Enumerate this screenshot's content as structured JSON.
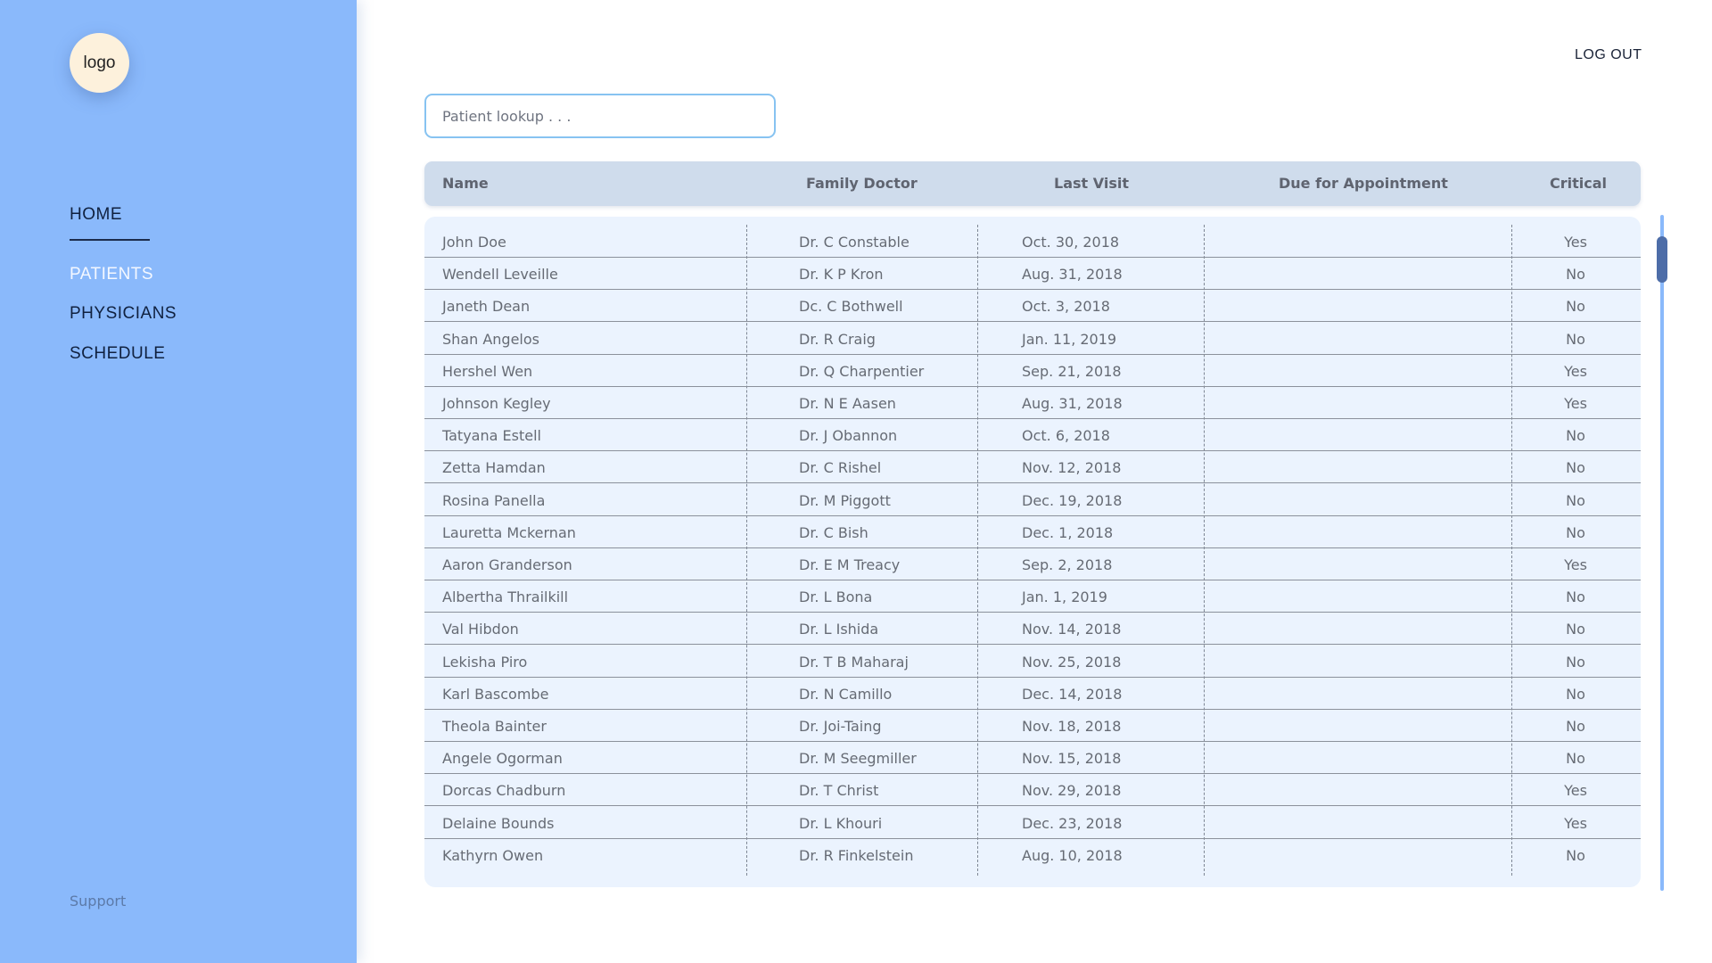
{
  "sidebar": {
    "logo": "logo",
    "nav": {
      "home": "HOME",
      "patients": "PATIENTS",
      "physicians": "PHYSICIANS",
      "schedule": "SCHEDULE"
    },
    "support": "Support"
  },
  "header": {
    "logout": "LOG OUT"
  },
  "search": {
    "placeholder": "Patient lookup . . ."
  },
  "table": {
    "columns": [
      "Name",
      "Family Doctor",
      "Last Visit",
      "Due for Appointment",
      "Critical"
    ],
    "rows": [
      {
        "name": "John Doe",
        "doctor": "Dr. C Constable",
        "last_visit": "Oct. 30, 2018",
        "due": "",
        "critical": "Yes"
      },
      {
        "name": "Wendell Leveille",
        "doctor": "Dr. K P Kron",
        "last_visit": "Aug. 31, 2018",
        "due": "",
        "critical": "No"
      },
      {
        "name": "Janeth Dean",
        "doctor": "Dc. C Bothwell",
        "last_visit": "Oct. 3, 2018",
        "due": "",
        "critical": "No"
      },
      {
        "name": "Shan Angelos",
        "doctor": "Dr. R Craig",
        "last_visit": "Jan. 11, 2019",
        "due": "",
        "critical": "No"
      },
      {
        "name": "Hershel Wen",
        "doctor": "Dr. Q Charpentier",
        "last_visit": "Sep. 21, 2018",
        "due": "",
        "critical": "Yes"
      },
      {
        "name": "Johnson Kegley",
        "doctor": "Dr. N E Aasen",
        "last_visit": "Aug. 31, 2018",
        "due": "",
        "critical": "Yes"
      },
      {
        "name": "Tatyana Estell",
        "doctor": "Dr. J Obannon",
        "last_visit": "Oct. 6, 2018",
        "due": "",
        "critical": "No"
      },
      {
        "name": "Zetta Hamdan",
        "doctor": "Dr. C Rishel",
        "last_visit": "Nov. 12, 2018",
        "due": "",
        "critical": "No"
      },
      {
        "name": "Rosina Panella",
        "doctor": "Dr. M Piggott",
        "last_visit": "Dec. 19, 2018",
        "due": "",
        "critical": "No"
      },
      {
        "name": "Lauretta Mckernan",
        "doctor": "Dr. C Bish",
        "last_visit": "Dec. 1, 2018",
        "due": "",
        "critical": "No"
      },
      {
        "name": "Aaron Granderson",
        "doctor": "Dr. E M Treacy",
        "last_visit": "Sep. 2, 2018",
        "due": "",
        "critical": "Yes"
      },
      {
        "name": "Albertha Thrailkill",
        "doctor": "Dr. L Bona",
        "last_visit": "Jan. 1, 2019",
        "due": "",
        "critical": "No"
      },
      {
        "name": "Val Hibdon",
        "doctor": "Dr. L Ishida",
        "last_visit": "Nov. 14, 2018",
        "due": "",
        "critical": "No"
      },
      {
        "name": "Lekisha Piro",
        "doctor": "Dr. T B Maharaj",
        "last_visit": "Nov. 25, 2018",
        "due": "",
        "critical": "No"
      },
      {
        "name": "Karl Bascombe",
        "doctor": "Dr. N Camillo",
        "last_visit": "Dec. 14, 2018",
        "due": "",
        "critical": "No"
      },
      {
        "name": "Theola Bainter",
        "doctor": "Dr. Joi-Taing",
        "last_visit": "Nov. 18, 2018",
        "due": "",
        "critical": "No"
      },
      {
        "name": "Angele Ogorman",
        "doctor": "Dr. M Seegmiller",
        "last_visit": "Nov. 15, 2018",
        "due": "",
        "critical": "No"
      },
      {
        "name": "Dorcas Chadburn",
        "doctor": "Dr. T Christ",
        "last_visit": "Nov. 29, 2018",
        "due": "",
        "critical": "Yes"
      },
      {
        "name": "Delaine Bounds",
        "doctor": "Dr. L Khouri",
        "last_visit": "Dec. 23, 2018",
        "due": "",
        "critical": "Yes"
      },
      {
        "name": "Kathyrn Owen",
        "doctor": "Dr. R Finkelstein",
        "last_visit": "Aug. 10, 2018",
        "due": "",
        "critical": "No"
      }
    ]
  },
  "colors": {
    "sidebar_bg": "#8ab9fb",
    "header_bg": "#cfdcec",
    "body_bg": "#ebf3fe",
    "search_border": "#87c3f1",
    "scroll_thumb": "#4d6da8"
  }
}
